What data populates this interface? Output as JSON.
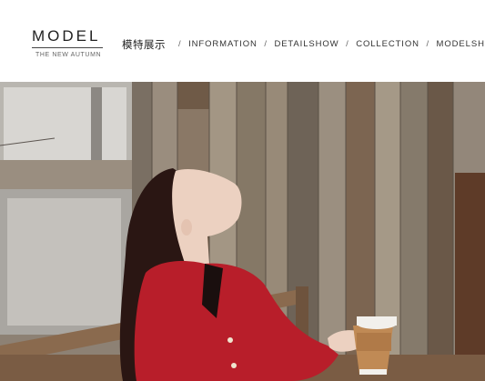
{
  "header": {
    "brand_title": "MODEL",
    "brand_subtitle": "THE NEW AUTUMN",
    "section_cn": "模特展示",
    "separator": "/",
    "nav_items": [
      "INFORMATION",
      "DETAILSHOW",
      "COLLECTION",
      "MODELSHOW"
    ]
  },
  "photo": {
    "subject": "model-in-red-tweed-jacket-with-coffee-cup"
  },
  "colors": {
    "jacket_red": "#b81e2a",
    "wood_gray": "#8a7f72",
    "wood_brown": "#6b4a33",
    "cup_tan": "#c08a55"
  }
}
